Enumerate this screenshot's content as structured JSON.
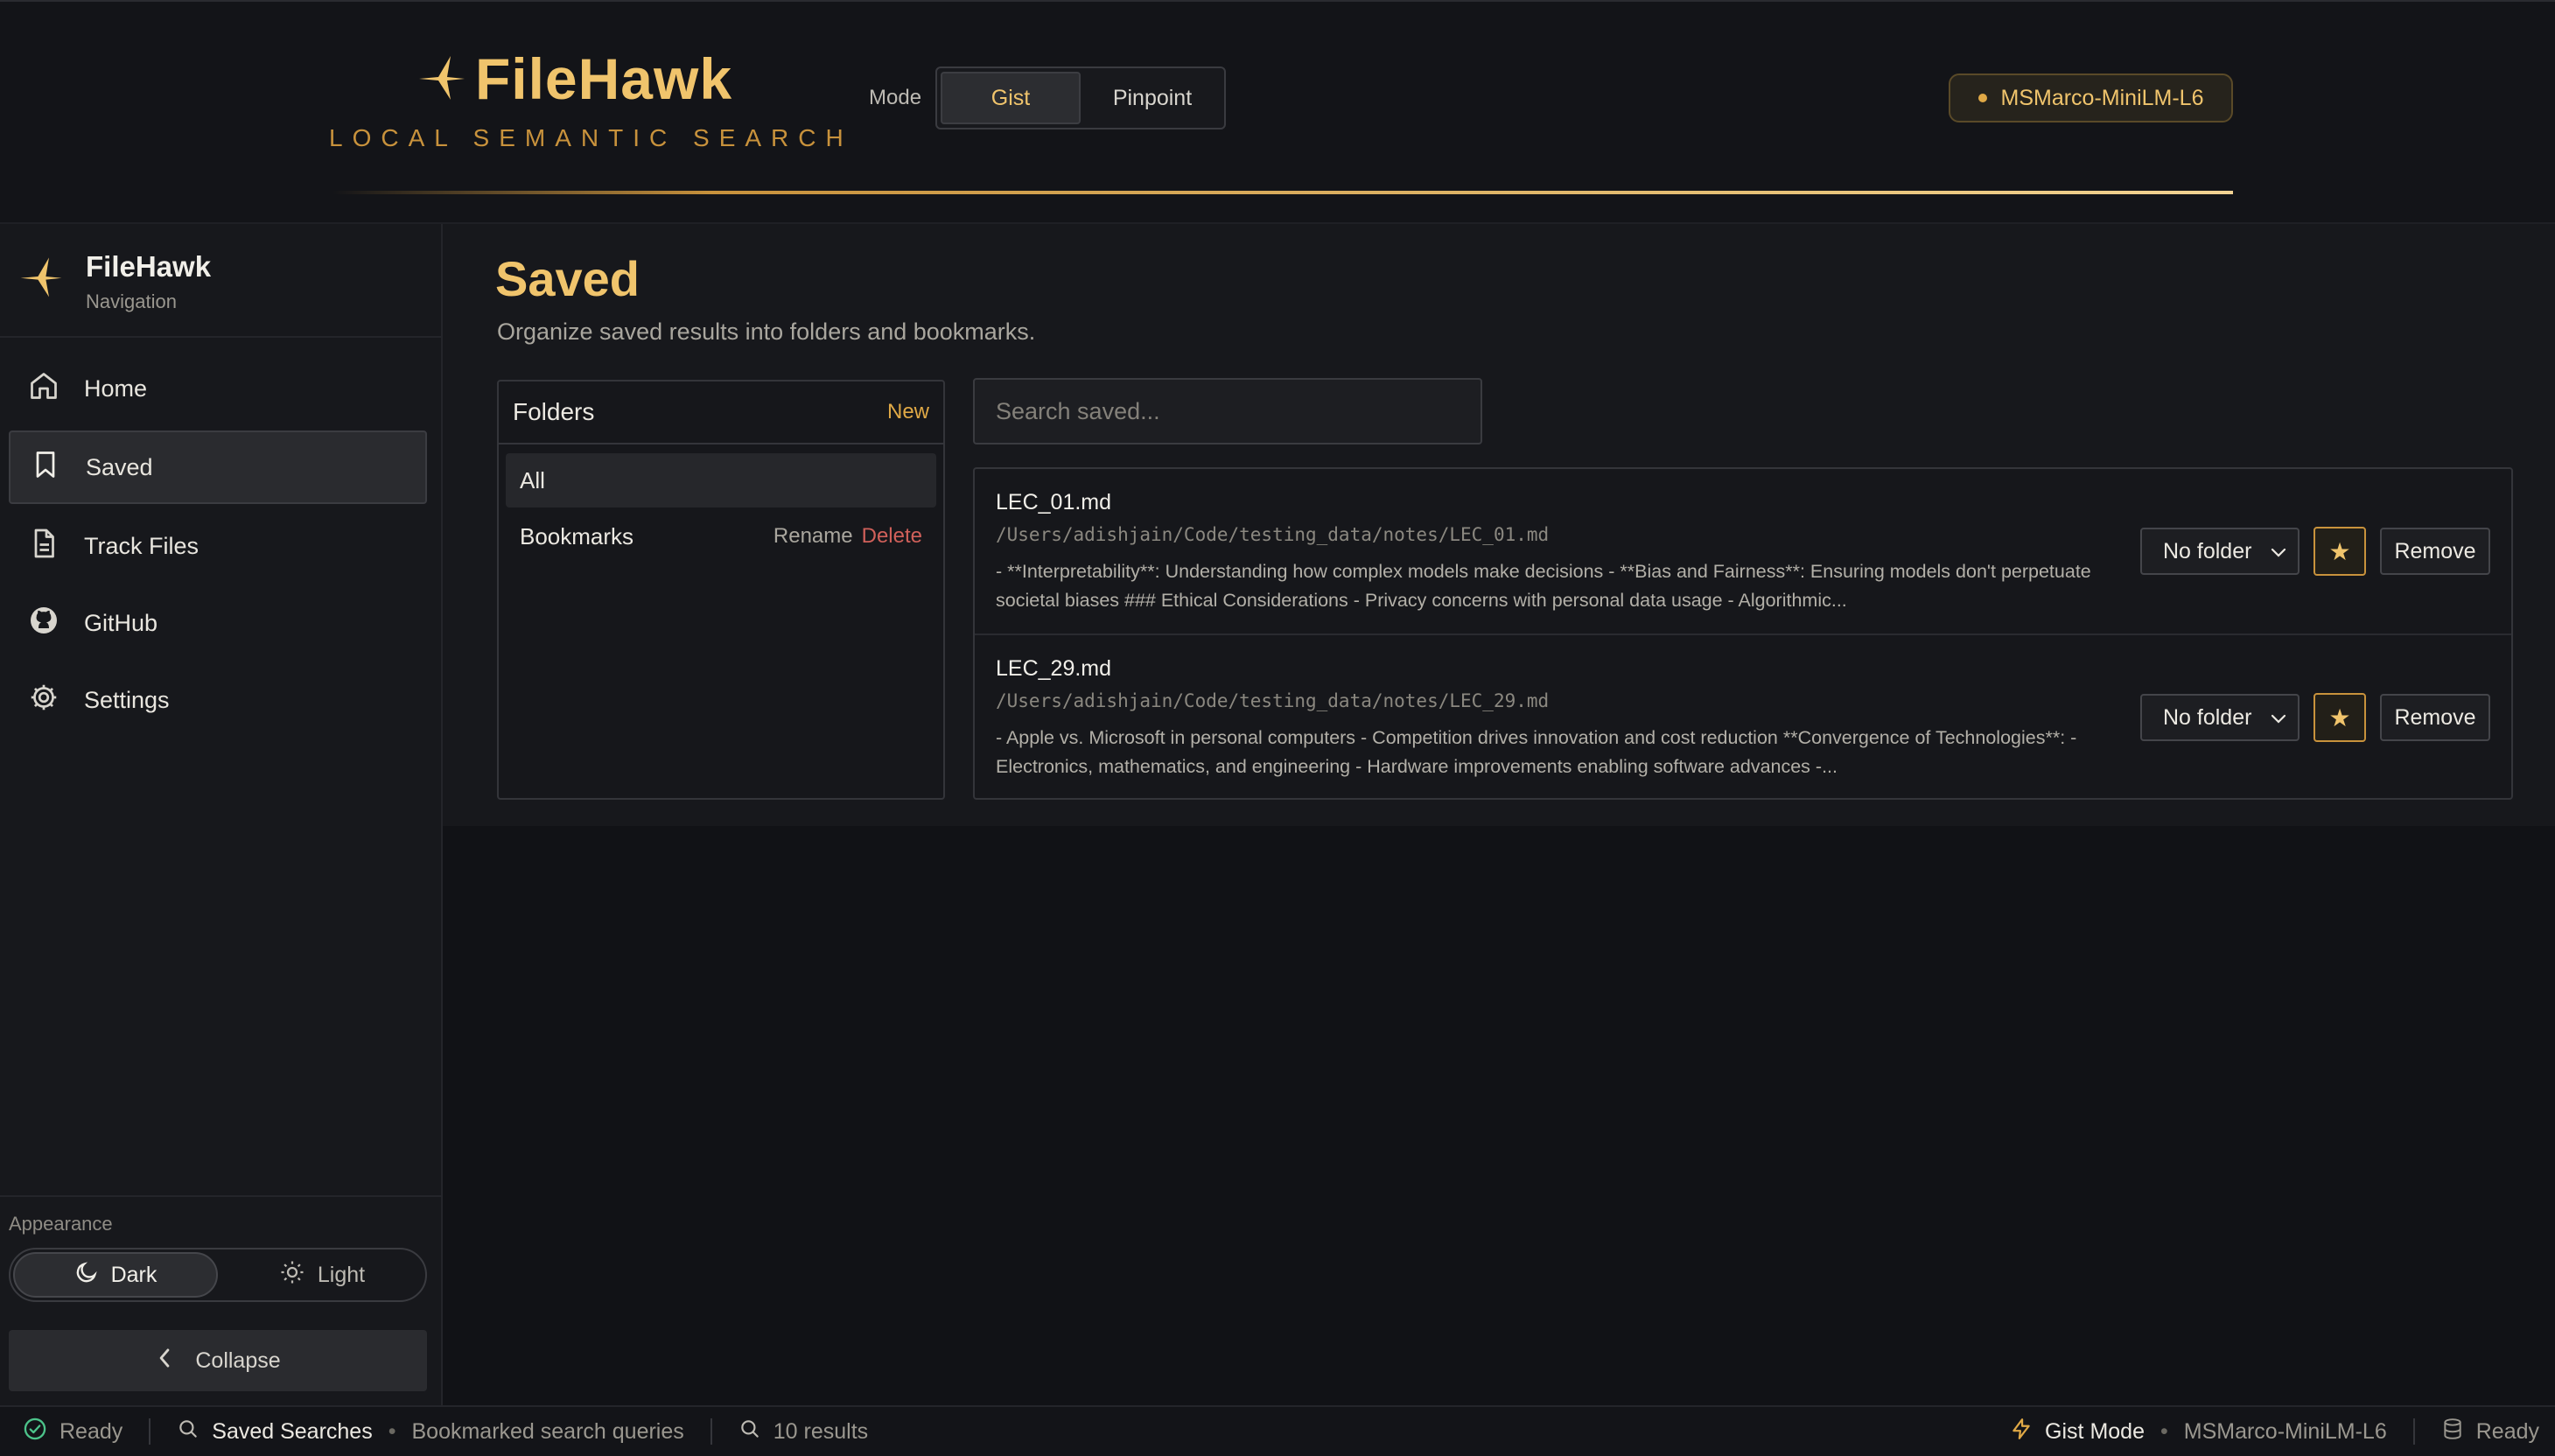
{
  "header": {
    "logo_title": "FileHawk",
    "logo_subtitle": "LOCAL SEMANTIC SEARCH",
    "mode_label": "Mode",
    "modes": [
      {
        "label": "Gist",
        "active": true
      },
      {
        "label": "Pinpoint",
        "active": false
      }
    ],
    "model_badge": "MSMarco-MiniLM-L6"
  },
  "sidebar": {
    "brand_title": "FileHawk",
    "brand_subtitle": "Navigation",
    "items": [
      {
        "label": "Home",
        "icon": "home-icon",
        "active": false
      },
      {
        "label": "Saved",
        "icon": "bookmark-icon",
        "active": true
      },
      {
        "label": "Track Files",
        "icon": "file-icon",
        "active": false
      },
      {
        "label": "GitHub",
        "icon": "github-icon",
        "active": false
      },
      {
        "label": "Settings",
        "icon": "gear-icon",
        "active": false
      }
    ],
    "appearance_label": "Appearance",
    "theme_dark": "Dark",
    "theme_light": "Light",
    "collapse_label": "Collapse"
  },
  "main": {
    "title": "Saved",
    "subtitle": "Organize saved results into folders and bookmarks.",
    "folders": {
      "title": "Folders",
      "new_label": "New",
      "items": [
        {
          "label": "All",
          "active": true
        },
        {
          "label": "Bookmarks",
          "rename": "Rename",
          "delete": "Delete"
        }
      ]
    },
    "search": {
      "placeholder": "Search saved...",
      "value": ""
    },
    "results": [
      {
        "name": "LEC_01.md",
        "path": "/Users/adishjain/Code/testing_data/notes/LEC_01.md",
        "snippet": "- **Interpretability**: Understanding how complex models make decisions - **Bias and Fairness**: Ensuring models don't perpetuate societal biases ### Ethical Considerations - Privacy concerns with personal data usage - Algorithmic...",
        "folder": "No folder",
        "star": "★",
        "remove": "Remove"
      },
      {
        "name": "LEC_29.md",
        "path": "/Users/adishjain/Code/testing_data/notes/LEC_29.md",
        "snippet": "- Apple vs. Microsoft in personal computers - Competition drives innovation and cost reduction **Convergence of Technologies**: - Electronics, mathematics, and engineering - Hardware improvements enabling software advances -...",
        "folder": "No folder",
        "star": "★",
        "remove": "Remove"
      }
    ]
  },
  "statusbar": {
    "status": "Ready",
    "section": "Saved Searches",
    "section_desc": "Bookmarked search queries",
    "results_count": "10 results",
    "mode": "Gist Mode",
    "model": "MSMarco-MiniLM-L6",
    "db_status": "Ready"
  },
  "colors": {
    "accent": "#f0c46c",
    "accent_dark": "#c8923c",
    "background": "#111216",
    "panel": "#17181c",
    "danger": "#d0605a",
    "success": "#4cc38a"
  }
}
